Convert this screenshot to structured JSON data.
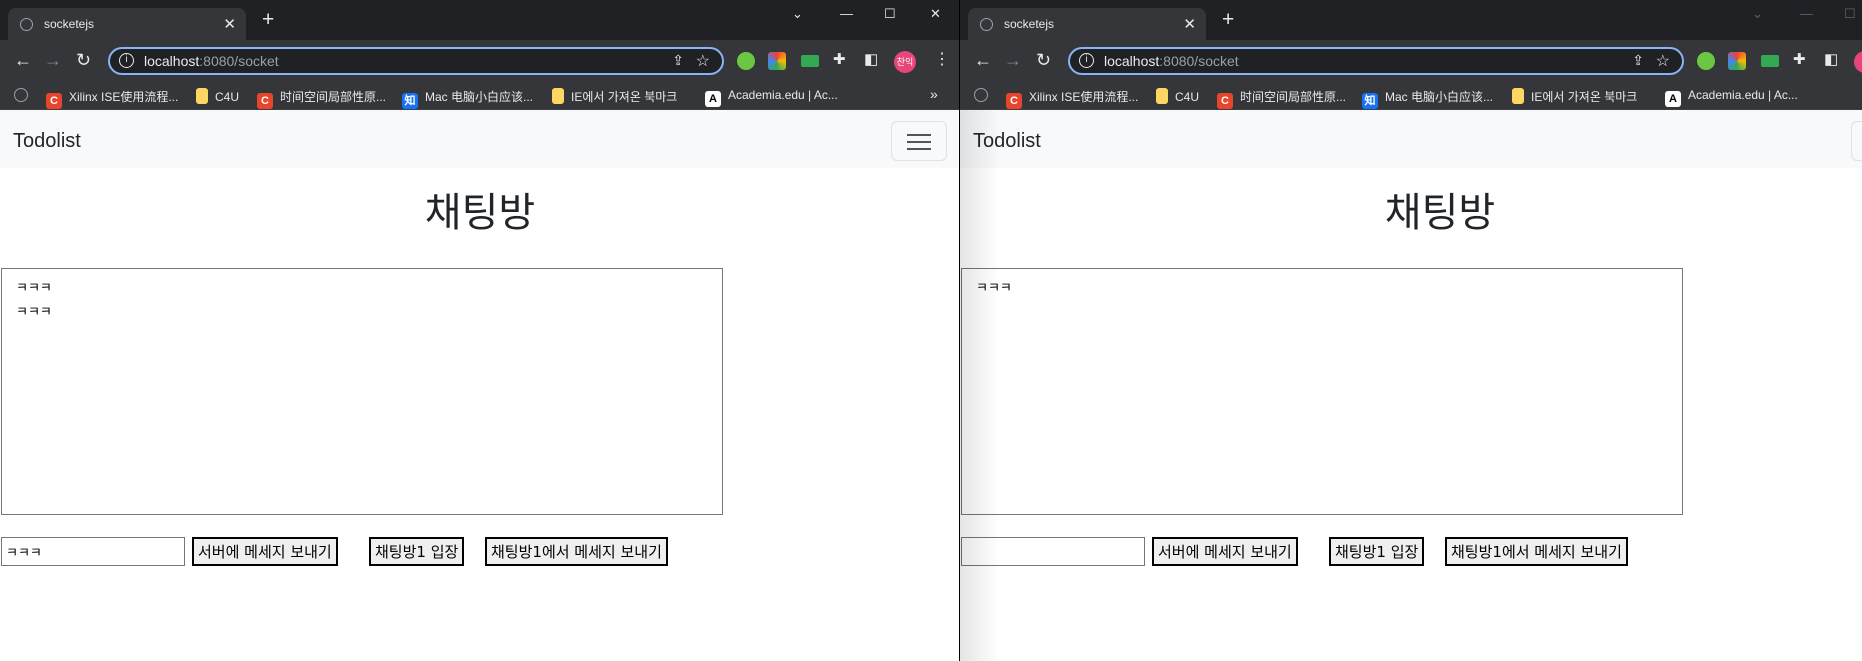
{
  "browser": {
    "tab_title": "socketejs",
    "tab_close": "✕",
    "new_tab": "+",
    "url_host": "localhost",
    "url_rest": ":8080/socket",
    "profile_initial": "찬익",
    "more_bookmarks": "»"
  },
  "bookmarks": [
    {
      "icon": "C",
      "label": "Xilinx ISE使用流程..."
    },
    {
      "icon": "",
      "label": "C4U"
    },
    {
      "icon": "C",
      "label": "时间空间局部性原..."
    },
    {
      "icon": "知",
      "label": "Mac 电脑小白应该..."
    },
    {
      "icon": "",
      "label": "IE에서 가져온 북마크"
    },
    {
      "icon": "A",
      "label": "Academia.edu | Ac..."
    }
  ],
  "navbar": {
    "brand": "Todolist"
  },
  "left": {
    "heading": "채팅방",
    "chat_log": "ㅋㅋㅋ\nㅋㅋㅋ",
    "input_value": "ㅋㅋㅋ"
  },
  "right": {
    "heading": "채팅방",
    "chat_log": "ㅋㅋㅋ",
    "input_value": ""
  },
  "buttons": {
    "send_server": "서버에 메세지 보내기",
    "join_room1": "채팅방1 입장",
    "send_room1": "채팅방1에서 메세지 보내기"
  },
  "colors": {
    "chrome_dark": "#202124",
    "chrome_toolbar": "#35363a",
    "focus_ring": "#8ab4f8",
    "navbar_bg": "#f8f9fa"
  }
}
